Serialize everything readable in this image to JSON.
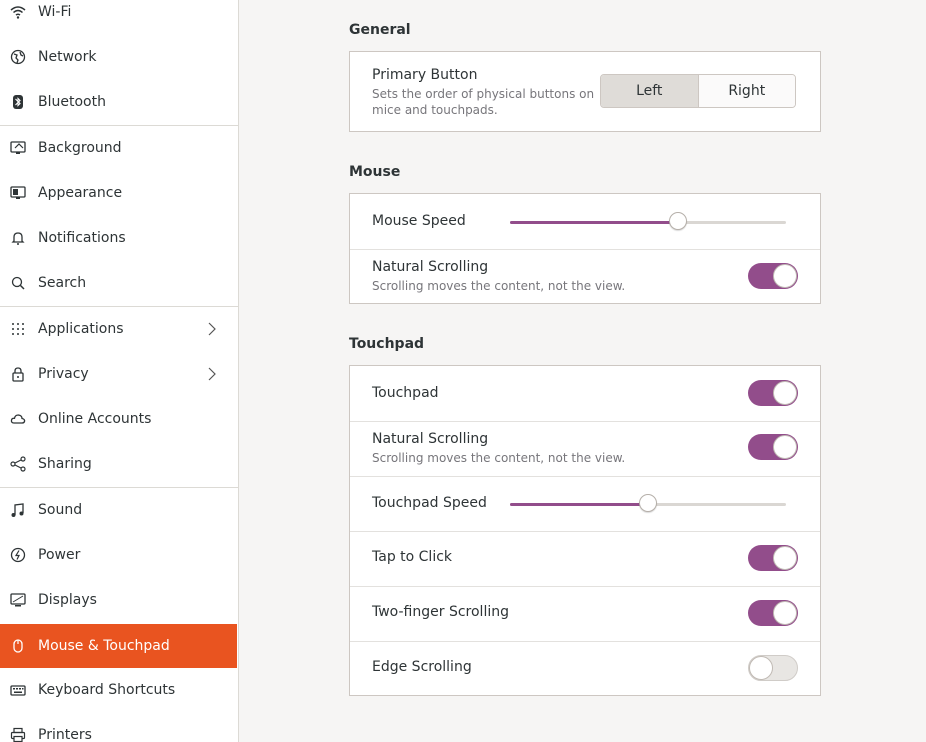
{
  "sidebar": {
    "items": [
      {
        "label": "Wi-Fi",
        "icon": "wifi-icon"
      },
      {
        "label": "Network",
        "icon": "network-icon"
      },
      {
        "label": "Bluetooth",
        "icon": "bluetooth-icon"
      },
      {
        "label": "Background",
        "icon": "background-icon"
      },
      {
        "label": "Appearance",
        "icon": "appearance-icon"
      },
      {
        "label": "Notifications",
        "icon": "bell-icon"
      },
      {
        "label": "Search",
        "icon": "search-icon"
      },
      {
        "label": "Applications",
        "icon": "grid-icon"
      },
      {
        "label": "Privacy",
        "icon": "lock-icon"
      },
      {
        "label": "Online Accounts",
        "icon": "cloud-icon"
      },
      {
        "label": "Sharing",
        "icon": "share-icon"
      },
      {
        "label": "Sound",
        "icon": "music-note-icon"
      },
      {
        "label": "Power",
        "icon": "power-icon"
      },
      {
        "label": "Displays",
        "icon": "display-icon"
      },
      {
        "label": "Mouse & Touchpad",
        "icon": "mouse-icon",
        "active": true
      },
      {
        "label": "Keyboard Shortcuts",
        "icon": "keyboard-icon"
      },
      {
        "label": "Printers",
        "icon": "printer-icon"
      }
    ]
  },
  "general": {
    "title": "General",
    "primary_button": {
      "title": "Primary Button",
      "subtitle": "Sets the order of physical buttons on mice and touchpads.",
      "options": [
        "Left",
        "Right"
      ],
      "selected": "Left"
    }
  },
  "mouse": {
    "title": "Mouse",
    "speed": {
      "title": "Mouse Speed",
      "value": 0.61
    },
    "natural_scrolling": {
      "title": "Natural Scrolling",
      "subtitle": "Scrolling moves the content, not the view.",
      "on": true
    }
  },
  "touchpad": {
    "title": "Touchpad",
    "touchpad": {
      "title": "Touchpad",
      "on": true
    },
    "natural_scrolling": {
      "title": "Natural Scrolling",
      "subtitle": "Scrolling moves the content, not the view.",
      "on": true
    },
    "speed": {
      "title": "Touchpad Speed",
      "value": 0.5
    },
    "tap_to_click": {
      "title": "Tap to Click",
      "on": true
    },
    "two_finger": {
      "title": "Two-finger Scrolling",
      "on": true
    },
    "edge": {
      "title": "Edge Scrolling",
      "on": false
    }
  },
  "colors": {
    "accent": "#e95420",
    "toggle_on": "#924d8b"
  }
}
